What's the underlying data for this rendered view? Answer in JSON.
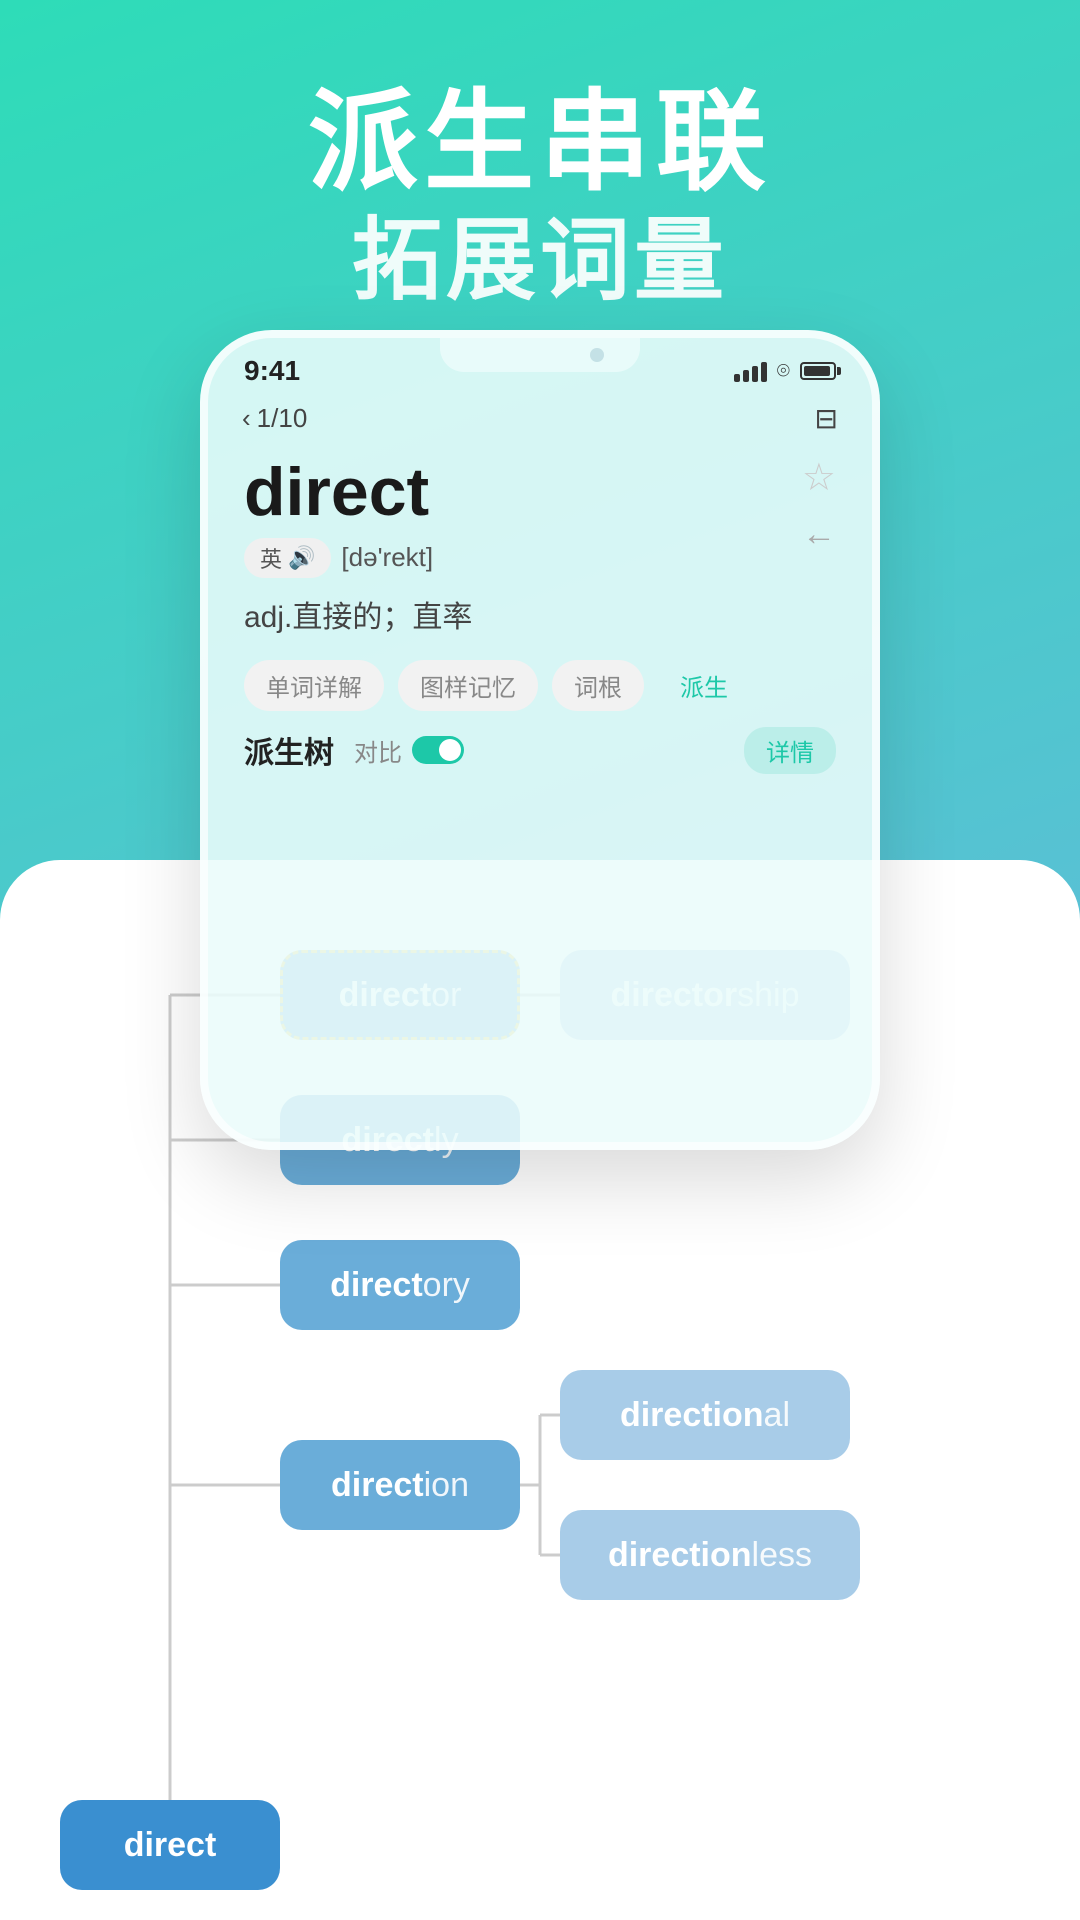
{
  "hero": {
    "line1": "派生串联",
    "line2": "拓展词量"
  },
  "statusBar": {
    "time": "9:41",
    "signal": "signal",
    "wifi": "wifi",
    "battery": "battery"
  },
  "nav": {
    "backLabel": "1/10"
  },
  "word": {
    "title": "direct",
    "phonetic": "[də'rekt]",
    "lang": "英",
    "meaning": "adj.直接的；直率",
    "star": "☆",
    "backArrow": "←"
  },
  "tabs": [
    {
      "label": "单词详解",
      "active": false
    },
    {
      "label": "图样记忆",
      "active": false
    },
    {
      "label": "词根",
      "active": false
    },
    {
      "label": "派生",
      "active": true
    }
  ],
  "derivative": {
    "sectionLabel": "派生树",
    "contrastLabel": "对比",
    "detailLabel": "详情"
  },
  "nodes": {
    "direct": {
      "root": "direct",
      "suffix": ""
    },
    "director": {
      "root": "direct",
      "suffix": "or"
    },
    "directorship": {
      "root": "director",
      "suffix": "ship"
    },
    "directly": {
      "root": "direct",
      "suffix": "ly"
    },
    "directory": {
      "root": "direct",
      "suffix": "ory"
    },
    "direction": {
      "root": "direct",
      "suffix": "ion"
    },
    "directional": {
      "root": "direction",
      "suffix": "al"
    },
    "directionless": {
      "root": "direction",
      "suffix": "less"
    }
  }
}
